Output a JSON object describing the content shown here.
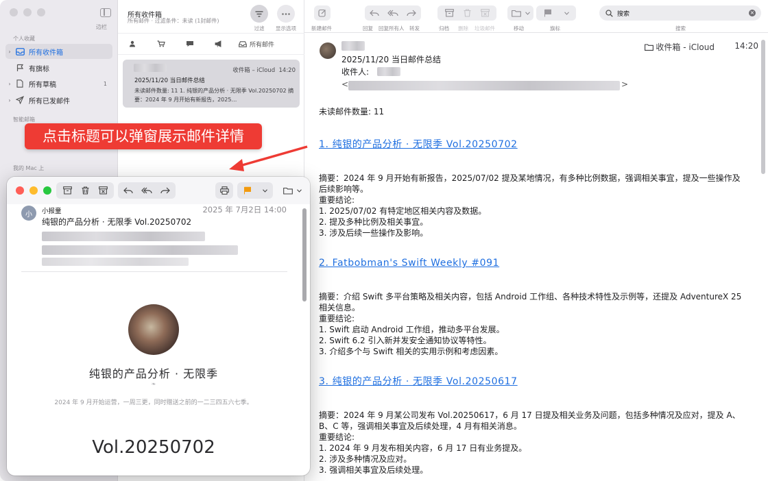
{
  "sidebar": {
    "toggle_label": "边栏",
    "sections": {
      "favorites": "个人收藏",
      "smart": "智能邮箱",
      "mac": "我的 Mac 上"
    },
    "items": [
      {
        "label": "所有收件箱",
        "count": ""
      },
      {
        "label": "有旗标",
        "count": ""
      },
      {
        "label": "所有草稿",
        "count": "1"
      },
      {
        "label": "所有已发邮件",
        "count": ""
      }
    ]
  },
  "list": {
    "title": "所有收件箱",
    "subtitle": "所有邮件 · 过滤条件：未读 (1封邮件)",
    "filter_label": "过滤",
    "view_options_label": "显示选项",
    "filter_all": "所有邮件",
    "message": {
      "account": "收件箱 – iCloud",
      "time": "14:20",
      "subject": "2025/11/20 当日邮件总结",
      "preview": "未读邮件数量: 11 1. 纯银的产品分析 · 无限季 Vol.20250702 摘要：2024 年 9 月开始有新报告，2025…"
    }
  },
  "toolbar": {
    "new_mail": "新建邮件",
    "reply": "回复",
    "reply_all": "回复所有人",
    "forward": "转发",
    "archive": "归档",
    "delete": "删除",
    "junk": "垃圾邮件",
    "move": "移动",
    "flag": "旗标",
    "search_value": "搜索",
    "search_label": "搜索"
  },
  "mail": {
    "subject": "2025/11/20 当日邮件总结",
    "to_label": "收件人:",
    "lt": "<",
    "gt": ">",
    "folder": "收件箱 - iCloud",
    "time": "14:20",
    "unread": "未读邮件数量: 11",
    "sections": [
      {
        "title": "1. 纯银的产品分析 · 无限季 Vol.20250702",
        "summary": "摘要：2024 年 9 月开始有新报告，2025/07/02 提及某地情况，有多种比例数据，强调相关事宜，提及一些操作及后续影响等。",
        "conclusions_label": "重要结论:",
        "points": [
          "1. 2025/07/02 有特定地区相关内容及数据。",
          "2. 提及多种比例及相关事宜。",
          "3. 涉及后续一些操作及影响。"
        ]
      },
      {
        "title": "2. Fatbobman's Swift Weekly #091",
        "summary": "摘要：介绍 Swift 多平台策略及相关内容，包括 Android 工作组、各种技术特性及示例等，还提及 AdventureX 25 相关信息。",
        "conclusions_label": "重要结论:",
        "points": [
          "1. Swift 启动 Android 工作组，推动多平台发展。",
          "2. Swift 6.2 引入新并发安全通知协议等特性。",
          "3. 介绍多个与 Swift 相关的实用示例和考虑因素。"
        ]
      },
      {
        "title": "3. 纯银的产品分析 · 无限季 Vol.20250617",
        "summary": "摘要：2024 年 9 月某公司发布 Vol.20250617，6 月 17 日提及相关业务及问题，包括多种情况及应对，提及 A、B、C 等，强调相关事宜及后续处理，4 月有相关消息。",
        "conclusions_label": "重要结论:",
        "points": [
          "1. 2024 年 9 月发布相关内容，6 月 17 日有业务提及。",
          "2. 涉及多种情况及应对。",
          "3. 强调相关事宜及后续处理。"
        ]
      }
    ]
  },
  "popup": {
    "avatar_letter": "小",
    "from": "小报童",
    "date": "2025 年 7月2日 14:00",
    "subject": "纯银的产品分析 · 无限季 Vol.20250702",
    "newsletter_name": "纯银的产品分析 · 无限季",
    "ornament": "❧",
    "description": "2024 年 9 月开始运营，一周三更，同时赠送之前的一二三四五六七季。",
    "volume": "Vol.20250702"
  },
  "annotation": {
    "text": "点击标题可以弹窗展示邮件详情",
    "color": "#ee3b34"
  },
  "colors": {
    "accent": "#1f6fe0",
    "flag": "#f29a0f",
    "close": "#ff5f57",
    "minimize": "#febc2e",
    "zoom": "#28c840"
  }
}
